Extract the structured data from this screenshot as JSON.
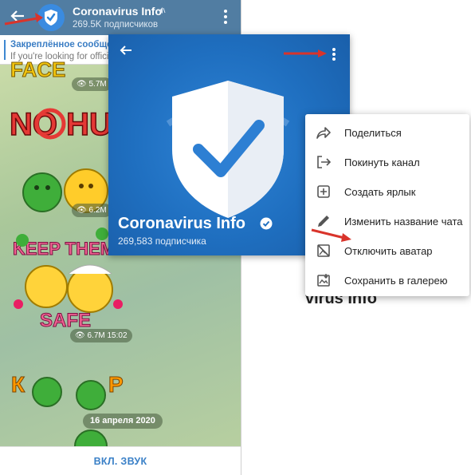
{
  "chat": {
    "title": "Coronavirus Info",
    "subscribers": "269.5K подписчиков",
    "pinned_title": "Закреплённое сообщени",
    "pinned_text": "If you're looking for offici",
    "messages": [
      {
        "views": "5.7M",
        "time": ""
      },
      {
        "views": "6.2M",
        "time": ""
      },
      {
        "views": "6.7M",
        "time": "15:02"
      }
    ],
    "sticker_texts": [
      "NO HUG",
      "KEEP THEM",
      "SAFE",
      "К",
      "Р"
    ],
    "date_divider": "16 апреля 2020",
    "unmute_label": "ВКЛ. ЗВУК"
  },
  "profile": {
    "title": "Coronavirus Info",
    "subscribers": "269,583 подписчика",
    "accent": "#1f6fc0"
  },
  "menu": {
    "items": [
      {
        "label": "Поделиться",
        "icon": "share-icon"
      },
      {
        "label": "Покинуть канал",
        "icon": "leave-icon"
      },
      {
        "label": "Создать ярлык",
        "icon": "add-shortcut-icon"
      },
      {
        "label": "Изменить название чата",
        "icon": "pencil-icon"
      },
      {
        "label": "Отключить аватар",
        "icon": "no-avatar-icon"
      },
      {
        "label": "Сохранить в галерею",
        "icon": "save-gallery-icon"
      }
    ]
  },
  "ghost_text": "virus Info",
  "colors": {
    "annotation_arrow": "#d9342b",
    "header": "#517da2"
  }
}
